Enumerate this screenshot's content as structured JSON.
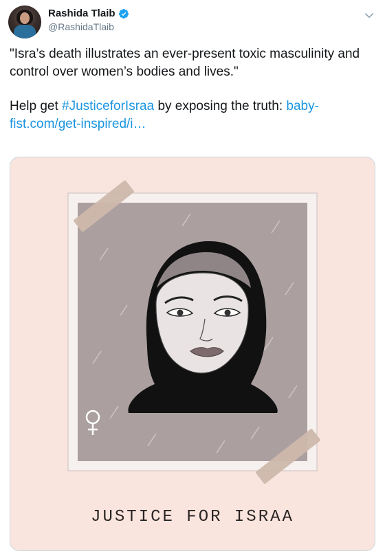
{
  "author": {
    "display_name": "Rashida Tlaib",
    "handle": "@RashidaTlaib",
    "verified": true
  },
  "tweet": {
    "paragraph1": "\"Isra’s death illustrates an ever-present toxic masculinity and control over women’s bodies and lives.\"",
    "paragraph2_prefix": "Help get ",
    "hashtag": "#JusticeforIsraa",
    "paragraph2_middle": " by exposing the truth: ",
    "url": "baby-fist.com/get-inspired/i…"
  },
  "media": {
    "caption": "JUSTICE FOR ISRAA",
    "background_color": "#f9e4de",
    "frame_color": "#a89b9c"
  },
  "icons": {
    "verified": "verified-badge-icon",
    "caret": "chevron-down-icon",
    "venus": "venus-symbol-icon"
  },
  "colors": {
    "link": "#1b95e0",
    "text": "#14171a",
    "secondary": "#657786"
  }
}
